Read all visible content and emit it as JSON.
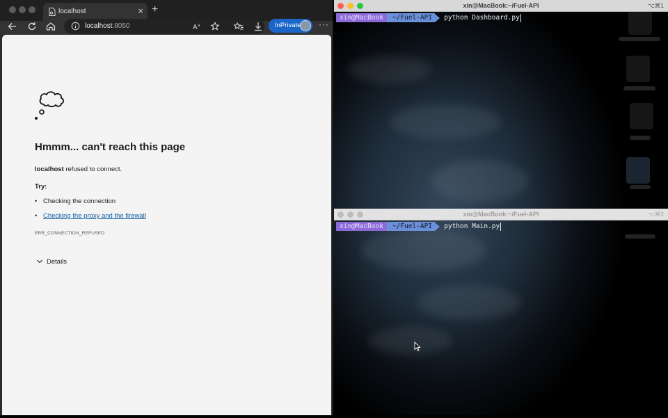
{
  "browser": {
    "tab": {
      "title": "localhost"
    },
    "address": {
      "host": "localhost",
      "port": ":8050"
    },
    "inprivate_label": "InPrivate",
    "error": {
      "title": "Hmmm... can't reach this page",
      "host": "localhost",
      "message": " refused to connect.",
      "try_label": "Try:",
      "suggestions": [
        {
          "text": "Checking the connection",
          "link": false
        },
        {
          "text": "Checking the proxy and the firewall",
          "link": true
        }
      ],
      "code": "ERR_CONNECTION_REFUSED",
      "details_label": "Details"
    }
  },
  "terminals": [
    {
      "title": "xin@MacBook:~/Fuel-API",
      "shortcut": "⌥⌘1",
      "user": "xin@MacBook",
      "path": "~/Fuel-API",
      "command": "python Dashboard.py",
      "active": true
    },
    {
      "title": "xin@MacBook:~/Fuel-API",
      "shortcut": "⌥⌘2",
      "user": "xin@MacBook",
      "path": "~/Fuel-API",
      "command": "python Main.py",
      "active": false
    }
  ],
  "colors": {
    "accent_blue": "#1a66c9",
    "link": "#115ea3",
    "prompt_user": "#8b6ad8",
    "prompt_path": "#6b8fd8"
  }
}
